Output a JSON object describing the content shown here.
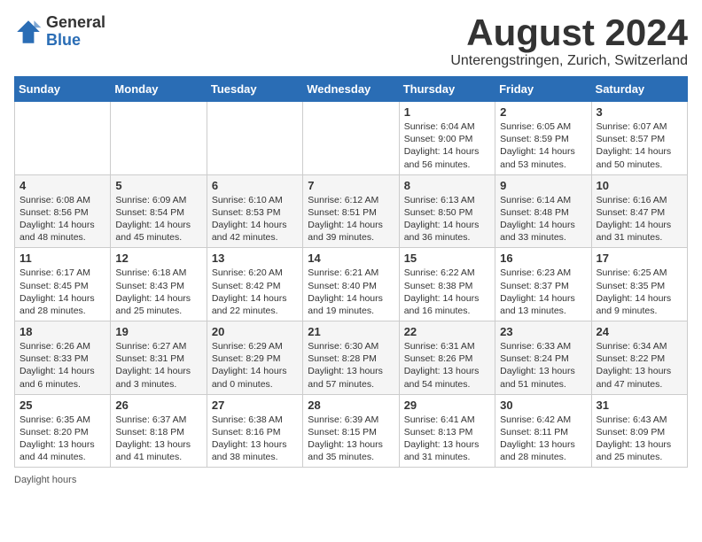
{
  "logo": {
    "general": "General",
    "blue": "Blue"
  },
  "title": {
    "month_year": "August 2024",
    "location": "Unterengstringen, Zurich, Switzerland"
  },
  "days_of_week": [
    "Sunday",
    "Monday",
    "Tuesday",
    "Wednesday",
    "Thursday",
    "Friday",
    "Saturday"
  ],
  "weeks": [
    [
      {
        "day": "",
        "info": ""
      },
      {
        "day": "",
        "info": ""
      },
      {
        "day": "",
        "info": ""
      },
      {
        "day": "",
        "info": ""
      },
      {
        "day": "1",
        "info": "Sunrise: 6:04 AM\nSunset: 9:00 PM\nDaylight: 14 hours and 56 minutes."
      },
      {
        "day": "2",
        "info": "Sunrise: 6:05 AM\nSunset: 8:59 PM\nDaylight: 14 hours and 53 minutes."
      },
      {
        "day": "3",
        "info": "Sunrise: 6:07 AM\nSunset: 8:57 PM\nDaylight: 14 hours and 50 minutes."
      }
    ],
    [
      {
        "day": "4",
        "info": "Sunrise: 6:08 AM\nSunset: 8:56 PM\nDaylight: 14 hours and 48 minutes."
      },
      {
        "day": "5",
        "info": "Sunrise: 6:09 AM\nSunset: 8:54 PM\nDaylight: 14 hours and 45 minutes."
      },
      {
        "day": "6",
        "info": "Sunrise: 6:10 AM\nSunset: 8:53 PM\nDaylight: 14 hours and 42 minutes."
      },
      {
        "day": "7",
        "info": "Sunrise: 6:12 AM\nSunset: 8:51 PM\nDaylight: 14 hours and 39 minutes."
      },
      {
        "day": "8",
        "info": "Sunrise: 6:13 AM\nSunset: 8:50 PM\nDaylight: 14 hours and 36 minutes."
      },
      {
        "day": "9",
        "info": "Sunrise: 6:14 AM\nSunset: 8:48 PM\nDaylight: 14 hours and 33 minutes."
      },
      {
        "day": "10",
        "info": "Sunrise: 6:16 AM\nSunset: 8:47 PM\nDaylight: 14 hours and 31 minutes."
      }
    ],
    [
      {
        "day": "11",
        "info": "Sunrise: 6:17 AM\nSunset: 8:45 PM\nDaylight: 14 hours and 28 minutes."
      },
      {
        "day": "12",
        "info": "Sunrise: 6:18 AM\nSunset: 8:43 PM\nDaylight: 14 hours and 25 minutes."
      },
      {
        "day": "13",
        "info": "Sunrise: 6:20 AM\nSunset: 8:42 PM\nDaylight: 14 hours and 22 minutes."
      },
      {
        "day": "14",
        "info": "Sunrise: 6:21 AM\nSunset: 8:40 PM\nDaylight: 14 hours and 19 minutes."
      },
      {
        "day": "15",
        "info": "Sunrise: 6:22 AM\nSunset: 8:38 PM\nDaylight: 14 hours and 16 minutes."
      },
      {
        "day": "16",
        "info": "Sunrise: 6:23 AM\nSunset: 8:37 PM\nDaylight: 14 hours and 13 minutes."
      },
      {
        "day": "17",
        "info": "Sunrise: 6:25 AM\nSunset: 8:35 PM\nDaylight: 14 hours and 9 minutes."
      }
    ],
    [
      {
        "day": "18",
        "info": "Sunrise: 6:26 AM\nSunset: 8:33 PM\nDaylight: 14 hours and 6 minutes."
      },
      {
        "day": "19",
        "info": "Sunrise: 6:27 AM\nSunset: 8:31 PM\nDaylight: 14 hours and 3 minutes."
      },
      {
        "day": "20",
        "info": "Sunrise: 6:29 AM\nSunset: 8:29 PM\nDaylight: 14 hours and 0 minutes."
      },
      {
        "day": "21",
        "info": "Sunrise: 6:30 AM\nSunset: 8:28 PM\nDaylight: 13 hours and 57 minutes."
      },
      {
        "day": "22",
        "info": "Sunrise: 6:31 AM\nSunset: 8:26 PM\nDaylight: 13 hours and 54 minutes."
      },
      {
        "day": "23",
        "info": "Sunrise: 6:33 AM\nSunset: 8:24 PM\nDaylight: 13 hours and 51 minutes."
      },
      {
        "day": "24",
        "info": "Sunrise: 6:34 AM\nSunset: 8:22 PM\nDaylight: 13 hours and 47 minutes."
      }
    ],
    [
      {
        "day": "25",
        "info": "Sunrise: 6:35 AM\nSunset: 8:20 PM\nDaylight: 13 hours and 44 minutes."
      },
      {
        "day": "26",
        "info": "Sunrise: 6:37 AM\nSunset: 8:18 PM\nDaylight: 13 hours and 41 minutes."
      },
      {
        "day": "27",
        "info": "Sunrise: 6:38 AM\nSunset: 8:16 PM\nDaylight: 13 hours and 38 minutes."
      },
      {
        "day": "28",
        "info": "Sunrise: 6:39 AM\nSunset: 8:15 PM\nDaylight: 13 hours and 35 minutes."
      },
      {
        "day": "29",
        "info": "Sunrise: 6:41 AM\nSunset: 8:13 PM\nDaylight: 13 hours and 31 minutes."
      },
      {
        "day": "30",
        "info": "Sunrise: 6:42 AM\nSunset: 8:11 PM\nDaylight: 13 hours and 28 minutes."
      },
      {
        "day": "31",
        "info": "Sunrise: 6:43 AM\nSunset: 8:09 PM\nDaylight: 13 hours and 25 minutes."
      }
    ]
  ],
  "footer": {
    "daylight_label": "Daylight hours"
  }
}
